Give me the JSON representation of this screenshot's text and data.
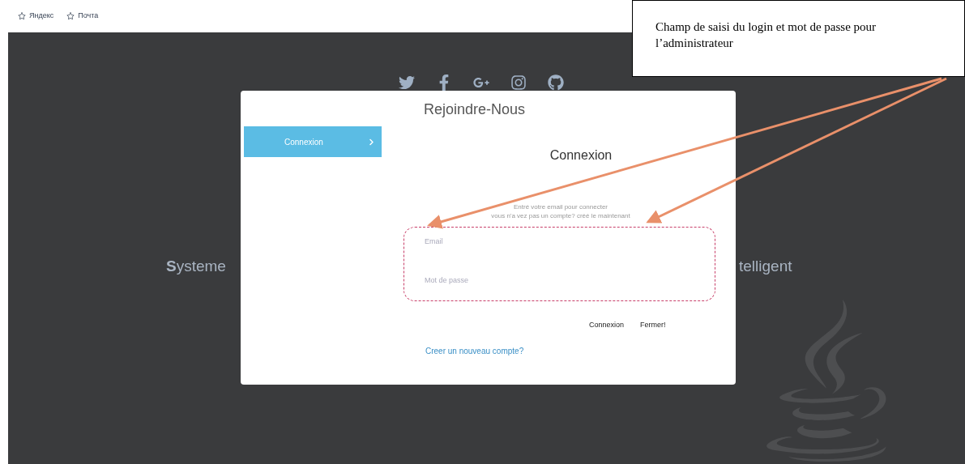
{
  "bookmarks": [
    {
      "label": "Яндекс"
    },
    {
      "label": "Почта"
    }
  ],
  "annotation": {
    "text": "Champ de saisi du login et mot de passe pour l’administrateur"
  },
  "social": [
    {
      "kind": "twitter"
    },
    {
      "kind": "facebook"
    },
    {
      "kind": "googleplus"
    },
    {
      "kind": "instagram"
    },
    {
      "kind": "github"
    }
  ],
  "hero": {
    "title_start": "**S**ysteme",
    "title_end": "telligent"
  },
  "modal": {
    "title": "Rejoindre-Nous",
    "tabs": [
      {
        "label": "Connexion",
        "selected": true
      }
    ],
    "heading": "Connexion",
    "intro": [
      "Entré votre email pour connecter",
      "vous n'a vez pas un compte? créé le maintenant"
    ],
    "fields": [
      {
        "placeholder": "Email"
      },
      {
        "placeholder": "Mot de passe"
      }
    ],
    "buttons": [
      "Connexion",
      "Fermer!"
    ],
    "link": "Creer un nouveau compte?"
  }
}
